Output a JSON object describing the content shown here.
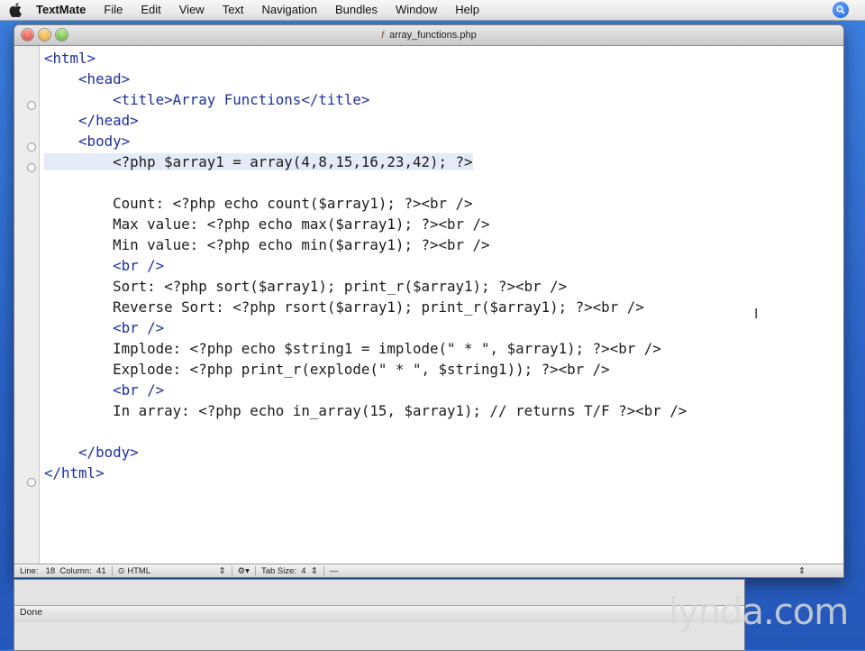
{
  "menubar": {
    "app": "TextMate",
    "items": [
      "File",
      "Edit",
      "View",
      "Text",
      "Navigation",
      "Bundles",
      "Window",
      "Help"
    ]
  },
  "window": {
    "title": "array_functions.php",
    "file_icon": "f"
  },
  "code_lines": [
    "<html>",
    "    <head>",
    "        <title>Array Functions</title>",
    "    </head>",
    "    <body>",
    "        <?php $array1 = array(4,8,15,16,23,42); ?>",
    "",
    "        Count: <?php echo count($array1); ?><br />",
    "        Max value: <?php echo max($array1); ?><br />",
    "        Min value: <?php echo min($array1); ?><br />",
    "        <br />",
    "        Sort: <?php sort($array1); print_r($array1); ?><br />",
    "        Reverse Sort: <?php rsort($array1); print_r($array1); ?><br />",
    "        <br />",
    "        Implode: <?php echo $string1 = implode(\" * \", $array1); ?><br />",
    "        Explode: <?php print_r(explode(\" * \", $string1)); ?><br />",
    "        <br />",
    "        In array: <?php echo in_array(15, $array1); // returns T/F ?><br />",
    "",
    "    </body>",
    "</html>"
  ],
  "statusbar": {
    "line_label": "Line:",
    "line_value": "18",
    "column_label": "Column:",
    "column_value": "41",
    "language": "HTML",
    "tab_label": "Tab Size:",
    "tab_value": "4",
    "symbol": "—"
  },
  "bottom": {
    "status": "Done"
  },
  "logo": "lynda.com"
}
